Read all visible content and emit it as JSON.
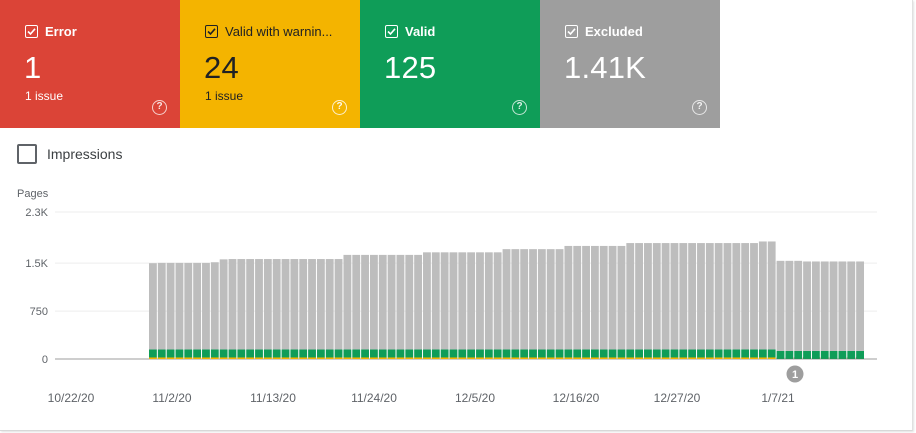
{
  "tiles": [
    {
      "label": "Error",
      "value": "1",
      "sub": "1 issue",
      "color": "#db4437",
      "checked": true
    },
    {
      "label": "Valid with warnin...",
      "value": "24",
      "sub": "1 issue",
      "color": "#f4b400",
      "checked": true
    },
    {
      "label": "Valid",
      "value": "125",
      "sub": "",
      "color": "#0f9d58",
      "checked": true
    },
    {
      "label": "Excluded",
      "value": "1.41K",
      "sub": "",
      "color": "#9e9e9e",
      "checked": true
    }
  ],
  "help_glyph": "?",
  "impressions": {
    "label": "Impressions",
    "checked": false
  },
  "chart_data": {
    "type": "bar",
    "ylabel": "Pages",
    "yticks": [
      "2.3K",
      "1.5K",
      "750",
      "0"
    ],
    "ylim": [
      0,
      2300
    ],
    "xticks": [
      "10/22/20",
      "11/2/20",
      "11/13/20",
      "11/24/20",
      "12/5/20",
      "12/16/20",
      "12/27/20",
      "1/7/21"
    ],
    "annotation": "1",
    "series": [
      {
        "name": "Excluded",
        "color": "#bdbdbd"
      },
      {
        "name": "Valid",
        "color": "#0f9d58"
      },
      {
        "name": "Valid with warnings",
        "color": "#f4b400"
      },
      {
        "name": "Error",
        "color": "#db4437"
      }
    ],
    "x_start": "10/31/20",
    "excluded": [
      1350,
      1355,
      1355,
      1355,
      1355,
      1355,
      1355,
      1365,
      1410,
      1415,
      1415,
      1415,
      1415,
      1415,
      1415,
      1415,
      1415,
      1415,
      1415,
      1415,
      1415,
      1415,
      1480,
      1480,
      1480,
      1480,
      1480,
      1480,
      1480,
      1480,
      1480,
      1520,
      1520,
      1520,
      1520,
      1520,
      1520,
      1520,
      1520,
      1520,
      1570,
      1570,
      1570,
      1570,
      1570,
      1570,
      1570,
      1620,
      1620,
      1620,
      1620,
      1620,
      1620,
      1620,
      1665,
      1665,
      1665,
      1665,
      1665,
      1665,
      1665,
      1665,
      1665,
      1665,
      1665,
      1665,
      1665,
      1665,
      1665,
      1690,
      1690,
      1410,
      1410,
      1410,
      1400,
      1400,
      1400,
      1400,
      1400,
      1400,
      1400
    ],
    "valid": [
      125,
      125,
      125,
      125,
      125,
      125,
      125,
      125,
      125,
      125,
      125,
      125,
      125,
      125,
      125,
      125,
      125,
      125,
      125,
      125,
      125,
      125,
      125,
      125,
      125,
      125,
      125,
      125,
      125,
      125,
      125,
      125,
      125,
      125,
      125,
      125,
      125,
      125,
      125,
      125,
      125,
      125,
      125,
      125,
      125,
      125,
      125,
      125,
      125,
      125,
      125,
      125,
      125,
      125,
      125,
      125,
      125,
      125,
      125,
      125,
      125,
      125,
      125,
      125,
      125,
      125,
      125,
      125,
      125,
      125,
      125,
      125,
      125,
      125,
      125,
      125,
      125,
      125,
      125,
      125,
      125
    ],
    "warning": [
      24,
      24,
      24,
      24,
      24,
      24,
      24,
      24,
      24,
      24,
      24,
      24,
      24,
      24,
      24,
      24,
      24,
      24,
      24,
      24,
      24,
      24,
      24,
      24,
      24,
      24,
      24,
      24,
      24,
      24,
      24,
      24,
      24,
      24,
      24,
      24,
      24,
      24,
      24,
      24,
      24,
      24,
      24,
      24,
      24,
      24,
      24,
      24,
      24,
      24,
      24,
      24,
      24,
      24,
      24,
      24,
      24,
      24,
      24,
      24,
      24,
      24,
      24,
      24,
      24,
      24,
      24,
      24,
      24,
      24,
      24,
      0,
      0,
      0,
      0,
      0,
      0,
      0,
      0,
      0,
      0
    ],
    "error": [
      0,
      0,
      0,
      0,
      0,
      0,
      0,
      0,
      0,
      0,
      0,
      0,
      0,
      0,
      0,
      0,
      0,
      0,
      0,
      0,
      0,
      0,
      0,
      0,
      0,
      0,
      0,
      0,
      0,
      0,
      0,
      0,
      0,
      0,
      0,
      0,
      0,
      0,
      0,
      0,
      0,
      0,
      0,
      0,
      0,
      0,
      0,
      0,
      0,
      0,
      0,
      0,
      0,
      0,
      0,
      0,
      0,
      0,
      0,
      0,
      0,
      0,
      0,
      0,
      0,
      0,
      0,
      0,
      0,
      0,
      0,
      1,
      1,
      1,
      1,
      1,
      1,
      1,
      1,
      1,
      1
    ]
  }
}
